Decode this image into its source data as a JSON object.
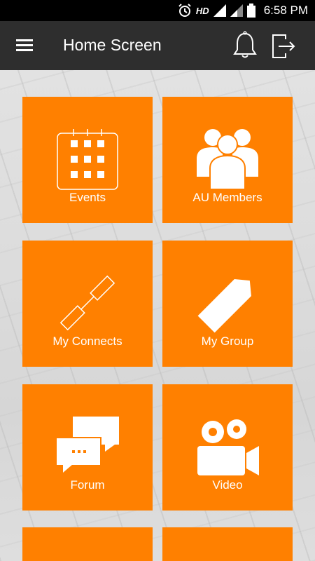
{
  "status_bar": {
    "network_label": "HD",
    "time": "6:58 PM"
  },
  "app_bar": {
    "title": "Home Screen",
    "menu_icon": "hamburger-menu-icon",
    "notification_icon": "bell-icon",
    "logout_icon": "logout-icon"
  },
  "tiles": [
    {
      "label": "Events",
      "icon": "calendar-icon"
    },
    {
      "label": "AU Members",
      "icon": "members-group-icon"
    },
    {
      "label": "My Connects",
      "icon": "chain-link-icon"
    },
    {
      "label": "My Group",
      "icon": "tag-icon"
    },
    {
      "label": "Forum",
      "icon": "chat-bubbles-icon"
    },
    {
      "label": "Video",
      "icon": "video-camera-icon"
    },
    {
      "label": "",
      "icon": ""
    },
    {
      "label": "",
      "icon": ""
    }
  ],
  "colors": {
    "tile": "#ff8000",
    "app_bar": "#2e2e2e",
    "status_bar": "#000000"
  }
}
